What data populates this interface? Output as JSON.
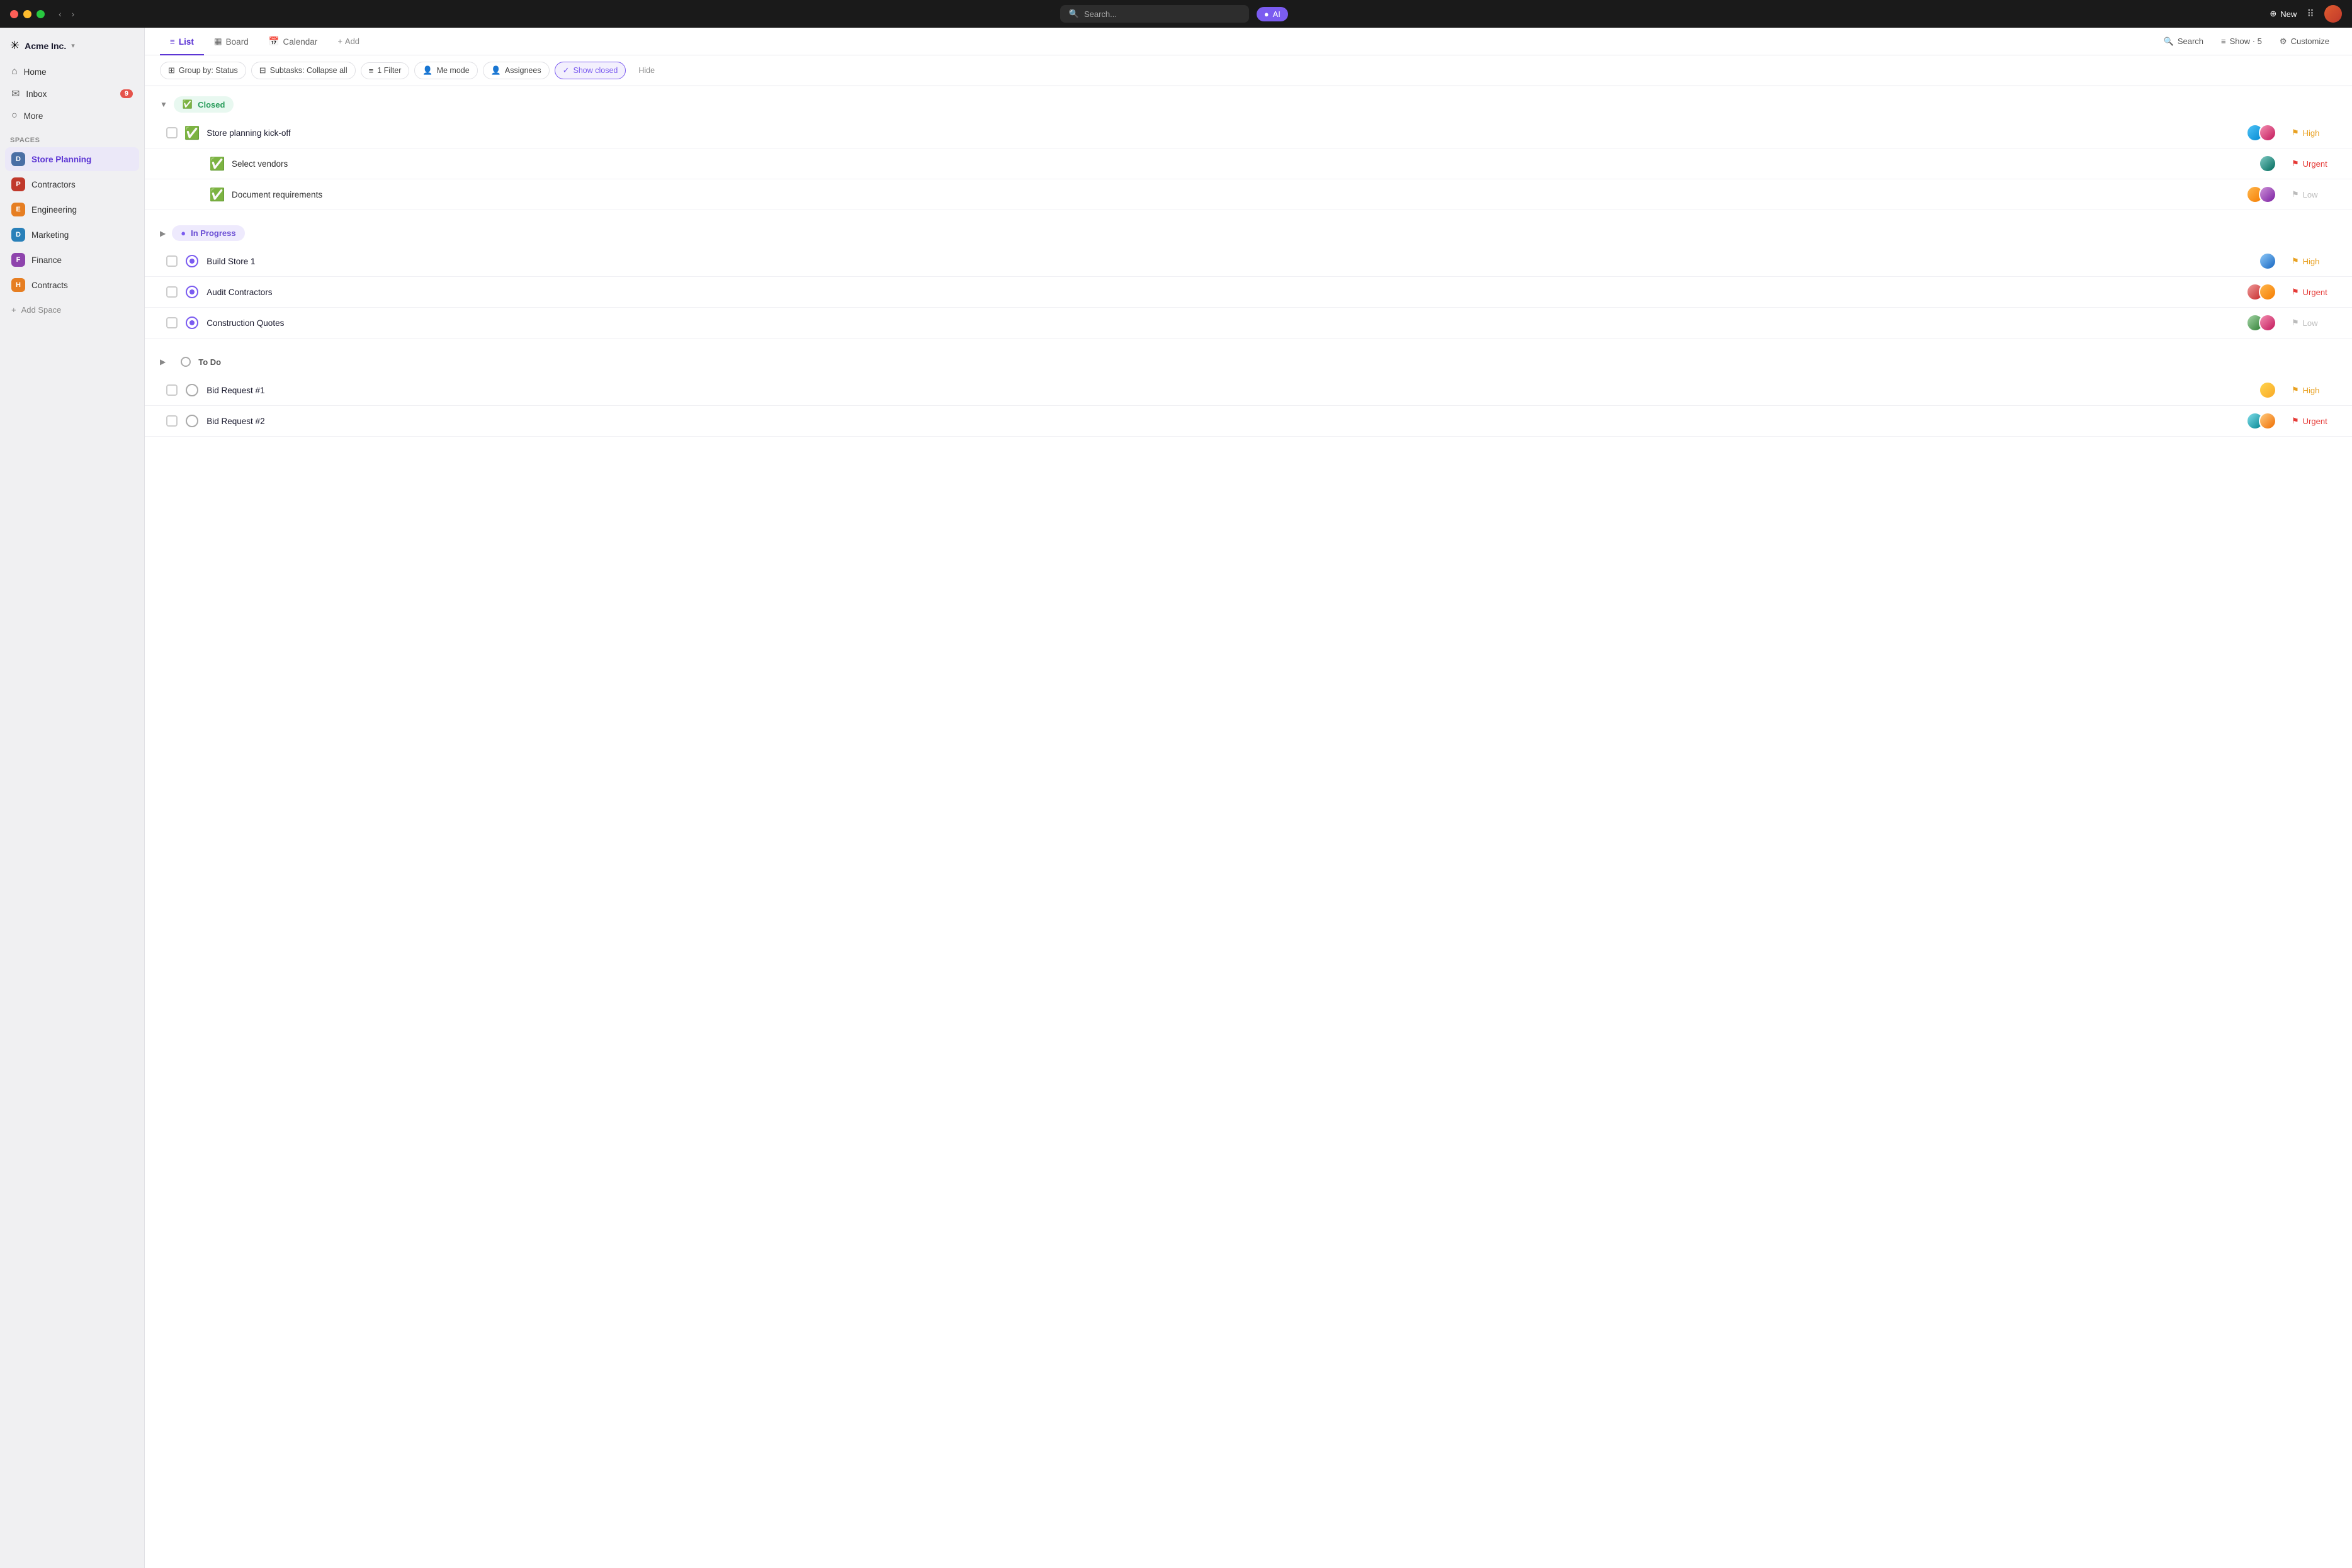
{
  "titleBar": {
    "searchPlaceholder": "Search...",
    "aiLabel": "AI",
    "newLabel": "New"
  },
  "sidebar": {
    "workspaceName": "Acme Inc.",
    "navItems": [
      {
        "id": "home",
        "icon": "⌂",
        "label": "Home"
      },
      {
        "id": "inbox",
        "icon": "✉",
        "label": "Inbox",
        "badge": "9"
      },
      {
        "id": "more",
        "icon": "○",
        "label": "More"
      }
    ],
    "sectionsLabel": "Spaces",
    "spaces": [
      {
        "id": "store-planning",
        "letter": "D",
        "color": "#4a6fa5",
        "label": "Store Planning",
        "active": true
      },
      {
        "id": "contractors",
        "letter": "P",
        "color": "#c0392b",
        "label": "Contractors"
      },
      {
        "id": "engineering",
        "letter": "E",
        "color": "#e67e22",
        "label": "Engineering"
      },
      {
        "id": "marketing",
        "letter": "D",
        "color": "#2980b9",
        "label": "Marketing"
      },
      {
        "id": "finance",
        "letter": "F",
        "color": "#8e44ad",
        "label": "Finance"
      },
      {
        "id": "contracts",
        "letter": "H",
        "color": "#e67e22",
        "label": "Contracts"
      }
    ],
    "addSpaceLabel": "Add Space"
  },
  "viewTabs": [
    {
      "id": "list",
      "icon": "≡",
      "label": "List",
      "active": true
    },
    {
      "id": "board",
      "icon": "▦",
      "label": "Board"
    },
    {
      "id": "calendar",
      "icon": "📅",
      "label": "Calendar"
    },
    {
      "id": "add",
      "icon": "+",
      "label": "Add"
    }
  ],
  "viewActions": [
    {
      "id": "search",
      "icon": "🔍",
      "label": "Search"
    },
    {
      "id": "show",
      "icon": "≡",
      "label": "Show · 5"
    },
    {
      "id": "customize",
      "icon": "⚙",
      "label": "Customize"
    }
  ],
  "filterBar": {
    "chips": [
      {
        "id": "group-by",
        "icon": "⊞",
        "label": "Group by: Status"
      },
      {
        "id": "subtasks",
        "icon": "⊟",
        "label": "Subtasks: Collapse all"
      },
      {
        "id": "filter",
        "icon": "≡",
        "label": "1 Filter"
      },
      {
        "id": "me-mode",
        "icon": "👤",
        "label": "Me mode"
      },
      {
        "id": "assignees",
        "icon": "👤",
        "label": "Assignees"
      },
      {
        "id": "show-closed",
        "icon": "✓",
        "label": "Show closed",
        "active": true
      }
    ],
    "hideLabel": "Hide"
  },
  "groups": [
    {
      "id": "closed",
      "status": "closed",
      "label": "Closed",
      "expanded": true,
      "tasks": [
        {
          "id": "t1",
          "name": "Store planning kick-off",
          "status": "closed",
          "assignees": [
            "av1",
            "av2"
          ],
          "priority": "High",
          "priorityLevel": "high"
        },
        {
          "id": "t2",
          "name": "Select vendors",
          "status": "closed",
          "assignees": [
            "av3"
          ],
          "priority": "Urgent",
          "priorityLevel": "urgent",
          "subtask": true
        },
        {
          "id": "t3",
          "name": "Document requirements",
          "status": "closed",
          "assignees": [
            "av4",
            "av5"
          ],
          "priority": "Low",
          "priorityLevel": "low",
          "subtask": true
        }
      ]
    },
    {
      "id": "in-progress",
      "status": "in-progress",
      "label": "In Progress",
      "expanded": true,
      "tasks": [
        {
          "id": "t4",
          "name": "Build Store 1",
          "status": "in-progress",
          "assignees": [
            "av8"
          ],
          "priority": "High",
          "priorityLevel": "high"
        },
        {
          "id": "t5",
          "name": "Audit Contractors",
          "status": "in-progress",
          "assignees": [
            "av6",
            "av4"
          ],
          "priority": "Urgent",
          "priorityLevel": "urgent"
        },
        {
          "id": "t6",
          "name": "Construction Quotes",
          "status": "in-progress",
          "assignees": [
            "av7",
            "av2"
          ],
          "priority": "Low",
          "priorityLevel": "low"
        }
      ]
    },
    {
      "id": "todo",
      "status": "todo",
      "label": "To Do",
      "expanded": true,
      "tasks": [
        {
          "id": "t7",
          "name": "Bid Request #1",
          "status": "todo",
          "assignees": [
            "av4"
          ],
          "priority": "High",
          "priorityLevel": "high"
        },
        {
          "id": "t8",
          "name": "Bid Request #2",
          "status": "todo",
          "assignees": [
            "av2",
            "av3"
          ],
          "priority": "Urgent",
          "priorityLevel": "urgent"
        }
      ]
    }
  ],
  "colors": {
    "accent": "#7b5cf0",
    "closedGreen": "#2a9d5c",
    "urgentRed": "#e53935",
    "highYellow": "#e8a020",
    "lowGray": "#bbb"
  }
}
